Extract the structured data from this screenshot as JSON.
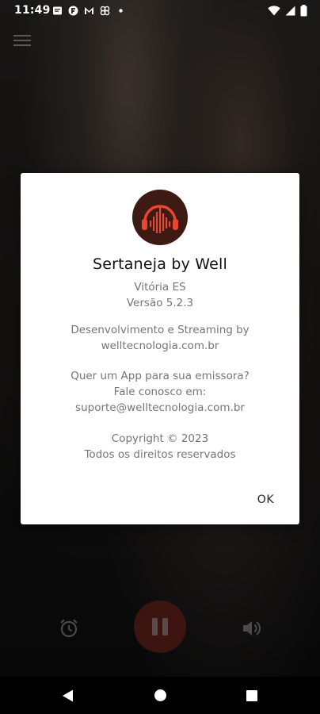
{
  "status_bar": {
    "time": "11:49"
  },
  "dialog": {
    "title": "Sertaneja by Well",
    "location": "Vitória ES",
    "version": "Versão 5.2.3",
    "dev_line1": "Desenvolvimento e Streaming by",
    "dev_line2": "welltecnologia.com.br",
    "promo_line1": "Quer um App para sua emissora?",
    "promo_line2": "Fale conosco em:",
    "promo_line3": "suporte@welltecnologia.com.br",
    "copyright_line1": "Copyright © 2023",
    "copyright_line2": "Todos os direitos reservados",
    "ok_label": "OK"
  },
  "colors": {
    "logo_accent": "#e8462e",
    "logo_background": "#3e1a15",
    "pause_button": "#3d1510"
  },
  "icons": [
    "menu-icon",
    "alarm-icon",
    "pause-icon",
    "volume-icon",
    "headphones-icon",
    "wifi-icon",
    "battery-icon"
  ]
}
